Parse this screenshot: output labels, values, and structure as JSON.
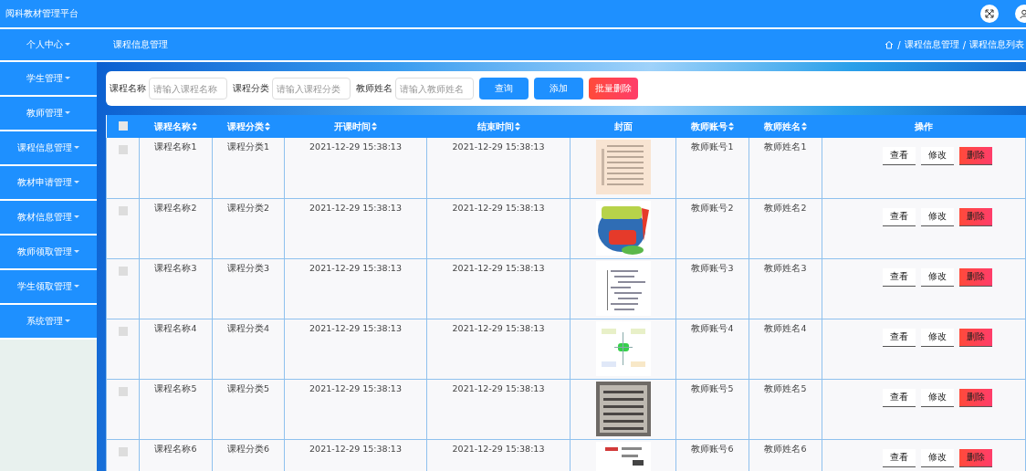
{
  "app": {
    "title": "阅科教材管理平台"
  },
  "sidebar": {
    "items": [
      {
        "label": "个人中心",
        "selected": false
      },
      {
        "label": "学生管理",
        "selected": false
      },
      {
        "label": "教师管理",
        "selected": false
      },
      {
        "label": "课程信息管理",
        "selected": false
      },
      {
        "label": "教材申请管理",
        "selected": false
      },
      {
        "label": "教材信息管理",
        "selected": false
      },
      {
        "label": "教师领取管理",
        "selected": false
      },
      {
        "label": "学生领取管理",
        "selected": false
      },
      {
        "label": "系统管理",
        "selected": false
      }
    ]
  },
  "header": {
    "title": "课程信息管理",
    "breadcrumb": [
      {
        "separator": "/",
        "label": "课程信息管理"
      },
      {
        "separator": "/",
        "label": "课程信息列表"
      }
    ]
  },
  "search": {
    "fields": [
      {
        "label": "课程名称",
        "placeholder": "请输入课程名称"
      },
      {
        "label": "课程分类",
        "placeholder": "请输入课程分类"
      },
      {
        "label": "教师姓名",
        "placeholder": "请输入教师姓名"
      }
    ],
    "buttons": [
      {
        "label": "查询",
        "kind": "primary"
      },
      {
        "label": "添加",
        "kind": "primary"
      },
      {
        "label": "批量删除",
        "kind": "danger"
      }
    ]
  },
  "table": {
    "select_all": {
      "checked": false
    },
    "columns": [
      {
        "label": "课程名称",
        "sortable": true
      },
      {
        "label": "课程分类",
        "sortable": true
      },
      {
        "label": "开课时间",
        "sortable": true
      },
      {
        "label": "结束时间",
        "sortable": true
      },
      {
        "label": "封面",
        "sortable": false
      },
      {
        "label": "教师账号",
        "sortable": true
      },
      {
        "label": "教师姓名",
        "sortable": true
      },
      {
        "label": "操作",
        "sortable": false
      }
    ],
    "rows": [
      {
        "checked": false,
        "cells": [
          "课程名称1",
          "课程分类1",
          "2021-12-29 15:38:13",
          "2021-12-29 15:38:13"
        ],
        "cover": {
          "kind": "picture"
        },
        "cells_after": [
          "教师账号1",
          "教师姓名1"
        ],
        "actions": [
          {
            "label": "查看",
            "kind": "link"
          },
          {
            "label": "修改",
            "kind": "link"
          },
          {
            "label": "删除",
            "kind": "danger"
          }
        ]
      },
      {
        "checked": false,
        "cells": [
          "课程名称2",
          "课程分类2",
          "2021-12-29 15:38:13",
          "2021-12-29 15:38:13"
        ],
        "cover": {
          "kind": "picture"
        },
        "cells_after": [
          "教师账号2",
          "教师姓名2"
        ],
        "actions": [
          {
            "label": "查看",
            "kind": "link"
          },
          {
            "label": "修改",
            "kind": "link"
          },
          {
            "label": "删除",
            "kind": "danger"
          }
        ]
      },
      {
        "checked": false,
        "cells": [
          "课程名称3",
          "课程分类3",
          "2021-12-29 15:38:13",
          "2021-12-29 15:38:13"
        ],
        "cover": {
          "kind": "picture"
        },
        "cells_after": [
          "教师账号3",
          "教师姓名3"
        ],
        "actions": [
          {
            "label": "查看",
            "kind": "link"
          },
          {
            "label": "修改",
            "kind": "link"
          },
          {
            "label": "删除",
            "kind": "danger"
          }
        ]
      },
      {
        "checked": false,
        "cells": [
          "课程名称4",
          "课程分类4",
          "2021-12-29 15:38:13",
          "2021-12-29 15:38:13"
        ],
        "cover": {
          "kind": "picture"
        },
        "cells_after": [
          "教师账号4",
          "教师姓名4"
        ],
        "actions": [
          {
            "label": "查看",
            "kind": "link"
          },
          {
            "label": "修改",
            "kind": "link"
          },
          {
            "label": "删除",
            "kind": "danger"
          }
        ]
      },
      {
        "checked": false,
        "cells": [
          "课程名称5",
          "课程分类5",
          "2021-12-29 15:38:13",
          "2021-12-29 15:38:13"
        ],
        "cover": {
          "kind": "picture"
        },
        "cells_after": [
          "教师账号5",
          "教师姓名5"
        ],
        "actions": [
          {
            "label": "查看",
            "kind": "link"
          },
          {
            "label": "修改",
            "kind": "link"
          },
          {
            "label": "删除",
            "kind": "danger"
          }
        ]
      },
      {
        "checked": false,
        "cells": [
          "课程名称6",
          "课程分类6",
          "2021-12-29 15:38:13",
          "2021-12-29 15:38:13"
        ],
        "cover": {
          "kind": "picture"
        },
        "cells_after": [
          "教师账号6",
          "教师姓名6"
        ],
        "actions": [
          {
            "label": "查看",
            "kind": "link"
          },
          {
            "label": "修改",
            "kind": "link"
          },
          {
            "label": "删除",
            "kind": "danger"
          }
        ]
      }
    ]
  }
}
